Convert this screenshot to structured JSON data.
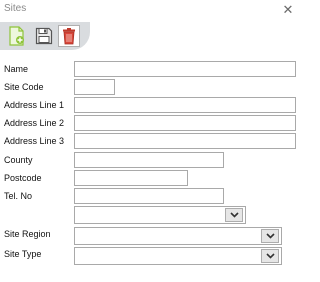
{
  "window": {
    "title": "Sites"
  },
  "toolbar": {
    "buttons": [
      {
        "name": "add-site-button",
        "icon": "document-add-icon"
      },
      {
        "name": "save-button",
        "icon": "floppy-disk-icon"
      },
      {
        "name": "delete-button",
        "icon": "trash-icon"
      }
    ]
  },
  "form": {
    "name_label": "Name",
    "site_code_label": "Site Code",
    "address1_label": "Address Line 1",
    "address2_label": "Address Line 2",
    "address3_label": "Address Line 3",
    "county_label": "County",
    "postcode_label": "Postcode",
    "tel_label": "Tel. No",
    "site_region_label": "Site Region",
    "site_type_label": "Site Type",
    "name_value": "",
    "site_code_value": "",
    "address1_value": "",
    "address2_value": "",
    "address3_value": "",
    "county_value": "",
    "postcode_value": "",
    "tel_value": "",
    "unlabeled_combo_value": "",
    "site_region_value": "",
    "site_type_value": ""
  },
  "colors": {
    "add_icon": "#8fc43a",
    "delete_icon": "#c0392b",
    "toolbar_bg": "#d9dcdf"
  }
}
